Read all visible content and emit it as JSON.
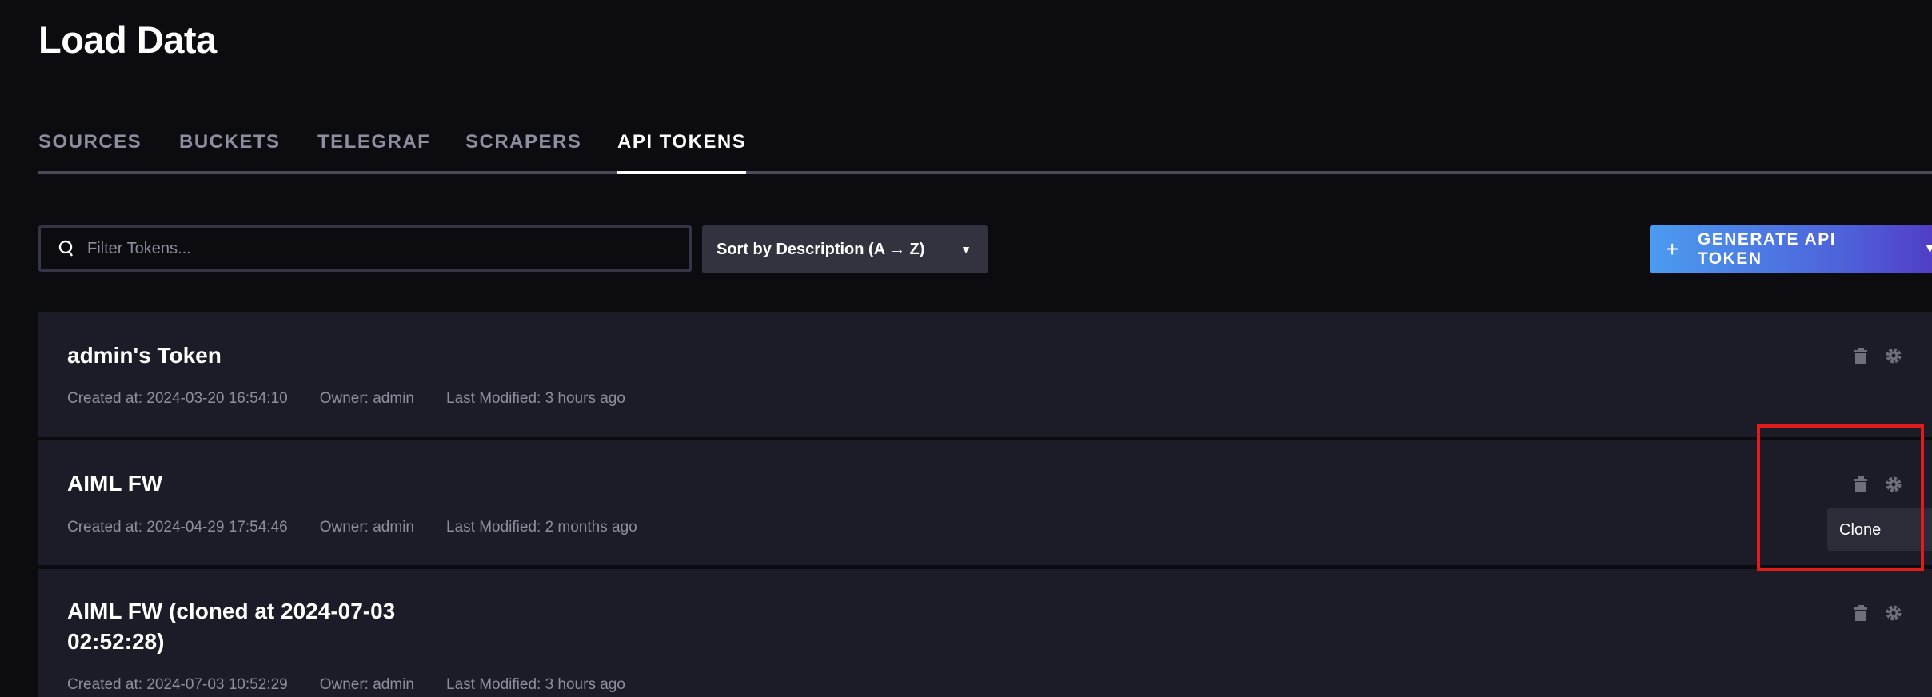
{
  "page_title": "Load Data",
  "tabs": [
    {
      "label": "SOURCES"
    },
    {
      "label": "BUCKETS"
    },
    {
      "label": "TELEGRAF"
    },
    {
      "label": "SCRAPERS"
    },
    {
      "label": "API TOKENS",
      "active": true
    }
  ],
  "filter": {
    "placeholder": "Filter Tokens...",
    "value": ""
  },
  "sort": {
    "label": "Sort by Description (A → Z)"
  },
  "generate_button": {
    "label": "GENERATE API TOKEN",
    "accent_gradient": [
      "#4b9cf0",
      "#513cc3"
    ]
  },
  "tokens": [
    {
      "name": "admin's Token",
      "created": "Created at: 2024-03-20 16:54:10",
      "owner": "Owner: admin",
      "modified": "Last Modified: 3 hours ago"
    },
    {
      "name": "AIML FW",
      "created": "Created at: 2024-04-29 17:54:46",
      "owner": "Owner: admin",
      "modified": "Last Modified: 2 months ago"
    },
    {
      "name": "AIML FW (cloned at 2024-07-03 02:52:28)",
      "created": "Created at: 2024-07-03 10:52:29",
      "owner": "Owner: admin",
      "modified": "Last Modified: 3 hours ago"
    }
  ],
  "context_menu": {
    "items": [
      {
        "label": "Clone"
      }
    ]
  },
  "highlight_color": "#e01b1b"
}
